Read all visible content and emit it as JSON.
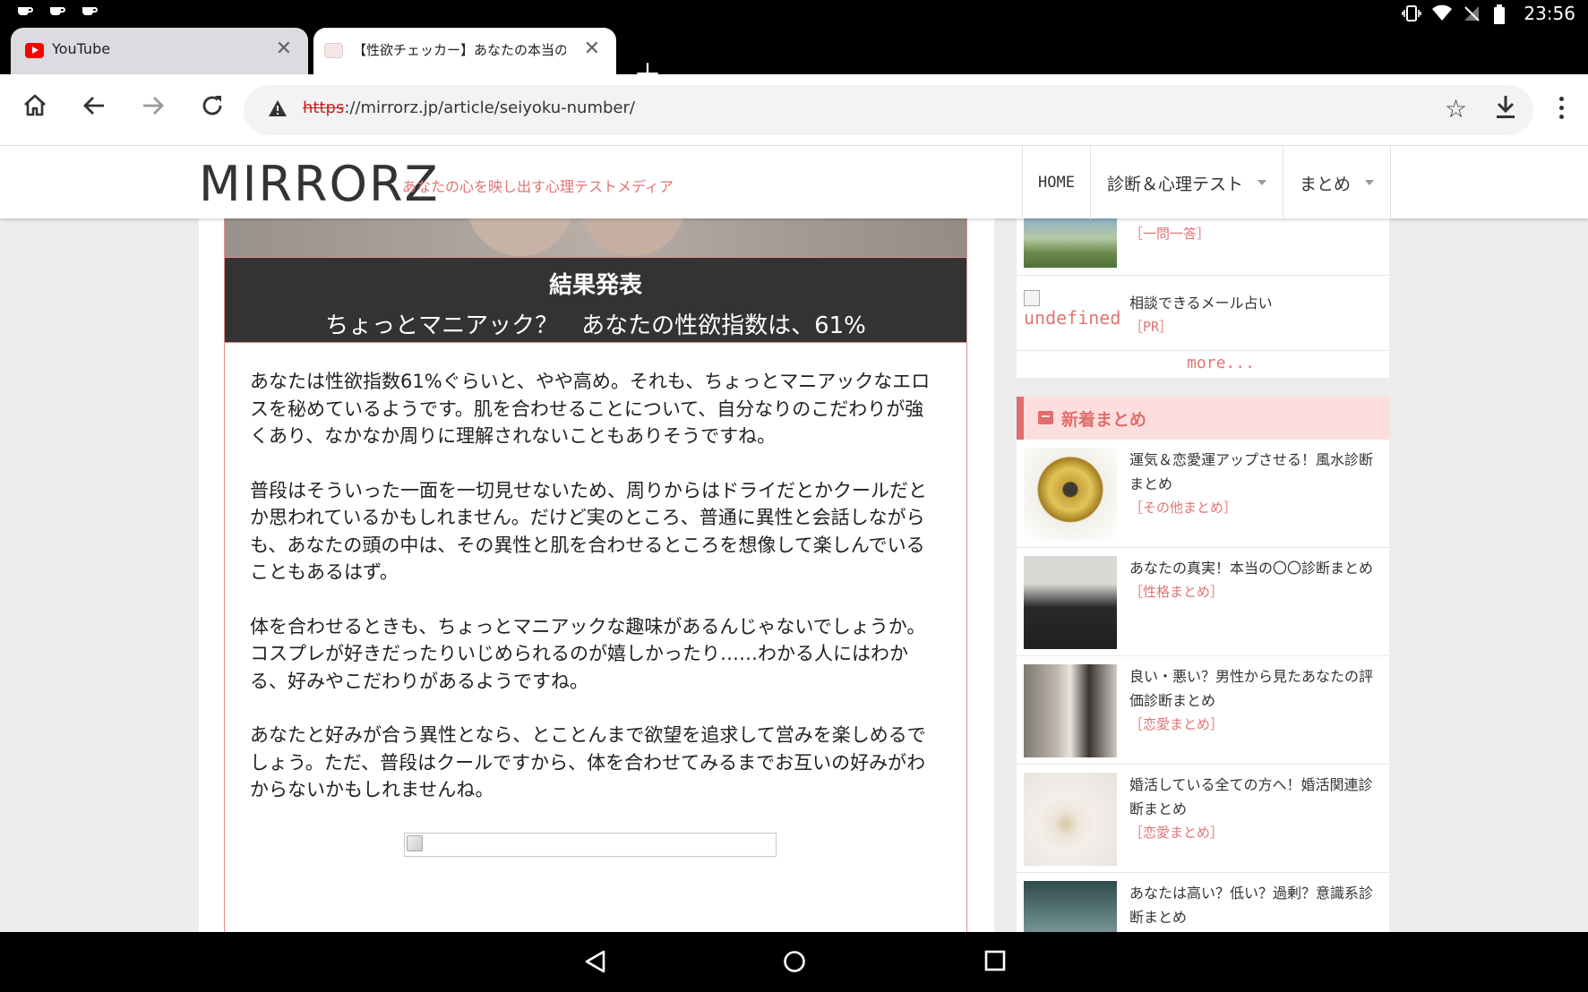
{
  "status_bar": {
    "time": "23:56"
  },
  "tabs": [
    {
      "title": "YouTube",
      "active": false
    },
    {
      "title": "【性欲チェッカー】あなたの本当の",
      "active": true
    }
  ],
  "omnibox": {
    "scheme": "https",
    "rest": "://mirrorz.jp/article/seiyoku-number/"
  },
  "site": {
    "logo": "MIRRORZ",
    "tagline": "あなたの心を映し出す心理テストメディア",
    "nav": [
      {
        "label": "HOME"
      },
      {
        "label": "診断＆心理テスト"
      },
      {
        "label": "まとめ"
      }
    ]
  },
  "article": {
    "result_heading": "結果発表",
    "result_sub": "ちょっとマニアック？　あなたの性欲指数は、61%",
    "paragraphs": [
      "あなたは性欲指数61%ぐらいと、やや高め。それも、ちょっとマニアックなエロスを秘めているようです。肌を合わせることについて、自分なりのこだわりが強くあり、なかなか周りに理解されないこともありそうですね。",
      "普段はそういった一面を一切見せないため、周りからはドライだとかクールだとか思われているかもしれません。だけど実のところ、普通に異性と会話しながらも、あなたの頭の中は、その異性と肌を合わせるところを想像して楽しんでいることもあるはず。",
      "体を合わせるときも、ちょっとマニアックな趣味があるんじゃないでしょうか。コスプレが好きだったりいじめられるのが嬉しかったり……わかる人にはわかる、好みやこだわりがあるようですね。",
      "あなたと好みが合う異性となら、とことんまで欲望を追求して営みを楽しめるでしょう。ただ、普段はクールですから、体を合わせてみるまでお互いの好みがわからないかもしれませんね。"
    ]
  },
  "sidebar": {
    "top_item1_cat": "［一問一答］",
    "top_item2": {
      "alt": "undefined",
      "title": "相談できるメール占い",
      "cat": "［PR］"
    },
    "more": "more...",
    "section_title": "新着まとめ",
    "items": [
      {
        "title": "運気＆恋愛運アップさせる！風水診断まとめ",
        "cat": "［その他まとめ］"
      },
      {
        "title": "あなたの真実！本当の〇〇診断まとめ",
        "cat": "［性格まとめ］"
      },
      {
        "title": "良い・悪い？男性から見たあなたの評価診断まとめ",
        "cat": "［恋愛まとめ］"
      },
      {
        "title": "婚活している全ての方へ！婚活関連診断まとめ",
        "cat": "［恋愛まとめ］"
      },
      {
        "title": "あなたは高い？低い？過剰？意識系診断まとめ",
        "cat": ""
      }
    ]
  }
}
